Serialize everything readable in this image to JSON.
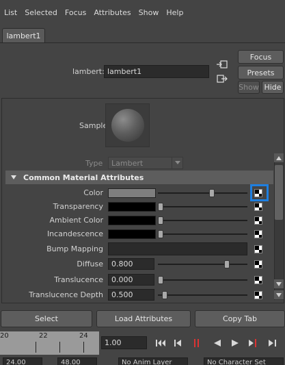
{
  "menu": [
    "List",
    "Selected",
    "Focus",
    "Attributes",
    "Show",
    "Help"
  ],
  "tab": "lambert1",
  "node": {
    "type_label": "lambert:",
    "name": "lambert1"
  },
  "side_buttons": {
    "focus": "Focus",
    "presets": "Presets",
    "show": "Show",
    "hide": "Hide"
  },
  "sample_label": "Sample",
  "type_row": {
    "label": "Type",
    "value": "Lambert"
  },
  "section_title": "Common Material Attributes",
  "attributes": [
    {
      "label": "Color",
      "kind": "color",
      "swatch": "#7f7f7f",
      "level": 0.62
    },
    {
      "label": "Transparency",
      "kind": "color",
      "swatch": "#000000",
      "level": 0.0
    },
    {
      "label": "Ambient Color",
      "kind": "color",
      "swatch": "#000000",
      "level": 0.0
    },
    {
      "label": "Incandescence",
      "kind": "color",
      "swatch": "#000000",
      "level": 0.0
    },
    {
      "label": "Bump Mapping",
      "kind": "bump"
    },
    {
      "label": "Diffuse",
      "kind": "number",
      "value": "0.800",
      "level": 0.8
    },
    {
      "label": "Translucence",
      "kind": "number",
      "value": "0.000",
      "level": 0.0
    },
    {
      "label": "Translucence Depth",
      "kind": "number",
      "value": "0.500",
      "level": 0.05
    }
  ],
  "bottom_buttons": {
    "select": "Select",
    "load": "Load Attributes",
    "copy": "Copy Tab"
  },
  "timeline": {
    "ticks": [
      "20",
      "22",
      "24"
    ],
    "current": "1.00"
  },
  "footer": {
    "start": "24.00",
    "end": "48.00",
    "anim_layer": "No Anim Layer",
    "char_set": "No Character Set"
  },
  "colors": {
    "highlight": "#1e7fe0"
  }
}
